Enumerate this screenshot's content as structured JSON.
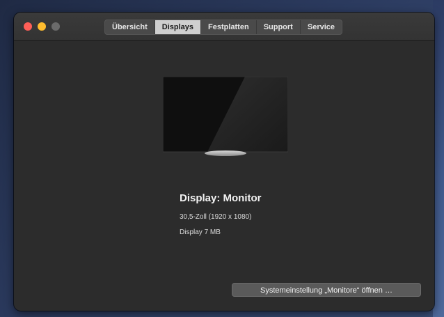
{
  "tabs": [
    {
      "label": "Übersicht",
      "active": false
    },
    {
      "label": "Displays",
      "active": true
    },
    {
      "label": "Festplatten",
      "active": false
    },
    {
      "label": "Support",
      "active": false
    },
    {
      "label": "Service",
      "active": false
    }
  ],
  "display": {
    "title": "Display: Monitor",
    "size": "30,5-Zoll (1920 x 1080)",
    "vram": "Display 7 MB"
  },
  "actions": {
    "open_prefs_label": "Systemeinstellung „Monitore“ öffnen …"
  },
  "colors": {
    "window_bg": "#2c2c2c",
    "close": "#ff5f57",
    "minimize": "#febc2e",
    "zoom_inactive": "#6b6b6b",
    "active_tab": "#cfcfcf"
  },
  "icons": {
    "display_image": "monitor-icon"
  }
}
